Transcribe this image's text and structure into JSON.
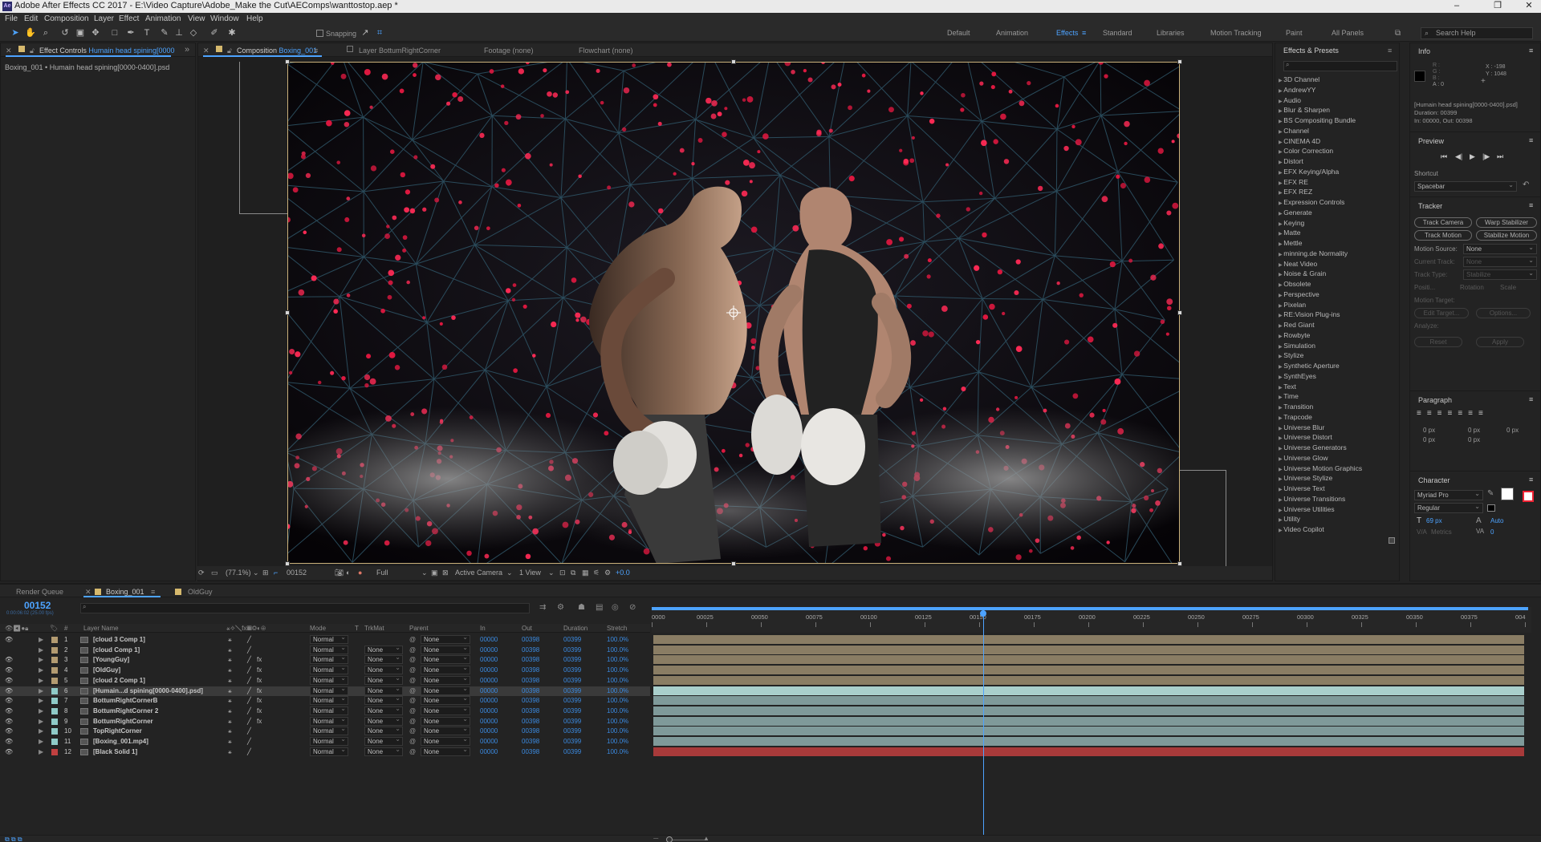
{
  "window": {
    "title": "Adobe After Effects CC 2017 - E:\\Video Capture\\Adobe_Make the Cut\\AEComps\\wanttostop.aep *",
    "app_icon": "Ae",
    "controls": [
      "minimize-icon",
      "restore-icon",
      "close-icon"
    ]
  },
  "menu": [
    "File",
    "Edit",
    "Composition",
    "Layer",
    "Effect",
    "Animation",
    "View",
    "Window",
    "Help"
  ],
  "toolbar": {
    "tools": [
      "selection-tool-icon",
      "hand-tool-icon",
      "zoom-tool-icon",
      "rotate-tool-icon",
      "camera-tool-icon",
      "pan-behind-tool-icon",
      "rectangle-tool-icon",
      "pen-tool-icon",
      "type-tool-icon",
      "brush-tool-icon",
      "clone-tool-icon",
      "eraser-tool-icon",
      "roto-tool-icon",
      "puppet-tool-icon"
    ],
    "snapping_label": "Snapping",
    "workspaces": [
      "Default",
      "Animation",
      "Effects",
      "Standard",
      "Libraries",
      "Motion Tracking",
      "Paint",
      "All Panels"
    ],
    "active_workspace": "Effects",
    "search_placeholder": "Search Help"
  },
  "effect_controls": {
    "tab_label": "Effect Controls",
    "tab_layer": "Humain head spining[0000",
    "subtitle": "Boxing_001 • Humain head spining[0000-0400].psd"
  },
  "viewer": {
    "tabs": {
      "composition_label": "Composition",
      "composition_name": "Boxing_001",
      "layer": "Layer BottumRightCorner",
      "footage": "Footage (none)",
      "flowchart": "Flowchart (none)"
    },
    "zoom": "(77.1%)",
    "timecode": "00152",
    "resolution": "Full",
    "camera": "Active Camera",
    "view": "1 View",
    "exposure": "+0.0"
  },
  "effects_presets": {
    "title": "Effects & Presets",
    "search_placeholder": "",
    "items": [
      "3D Channel",
      "AndrewYY",
      "Audio",
      "Blur & Sharpen",
      "BS Compositing Bundle",
      "Channel",
      "CINEMA 4D",
      "Color Correction",
      "Distort",
      "EFX Keying/Alpha",
      "EFX RE",
      "EFX REZ",
      "Expression Controls",
      "Generate",
      "Keying",
      "Matte",
      "Mettle",
      "minning.de Normality",
      "Neat Video",
      "Noise & Grain",
      "Obsolete",
      "Perspective",
      "Pixelan",
      "RE:Vision Plug-ins",
      "Red Giant",
      "Rowbyte",
      "Simulation",
      "Stylize",
      "Synthetic Aperture",
      "SynthEyes",
      "Text",
      "Time",
      "Transition",
      "Trapcode",
      "Universe Blur",
      "Universe Distort",
      "Universe Generators",
      "Universe Glow",
      "Universe Motion Graphics",
      "Universe Stylize",
      "Universe Text",
      "Universe Transitions",
      "Universe Utilities",
      "Utility",
      "Video Copilot"
    ]
  },
  "info": {
    "title": "Info",
    "channels": [
      "R :",
      "G :",
      "B :",
      "A : 0"
    ],
    "x": "X : -198",
    "y": "Y : 1048",
    "layer_name": "[Humain head spining[0000-0400].psd]",
    "duration": "Duration: 00399",
    "in_out": "In: 00000, Out: 00398"
  },
  "preview": {
    "title": "Preview",
    "shortcut_label": "Shortcut",
    "shortcut_value": "Spacebar"
  },
  "tracker": {
    "title": "Tracker",
    "buttons": [
      "Track Camera",
      "Warp Stabilizer",
      "Track Motion",
      "Stabilize Motion"
    ],
    "motion_source_label": "Motion Source:",
    "motion_source_value": "None",
    "current_track_label": "Current Track:",
    "current_track_value": "None",
    "track_type_label": "Track Type:",
    "track_type_value": "Stabilize",
    "checks": [
      "Positi...",
      "Rotation",
      "Scale"
    ],
    "motion_target": "Motion Target:",
    "edit_target": "Edit Target...",
    "options": "Options...",
    "analyze": "Analyze:",
    "reset": "Reset",
    "apply": "Apply"
  },
  "paragraph": {
    "title": "Paragraph",
    "values": [
      "0 px",
      "0 px",
      "0 px",
      "0 px",
      "0 px"
    ]
  },
  "character": {
    "title": "Character",
    "font": "Myriad Pro",
    "style": "Regular",
    "size": "69 px",
    "leading": "Auto",
    "tracking_label": "Metrics",
    "kerning_value": "0"
  },
  "timeline": {
    "tabs": [
      "Render Queue",
      "Boxing_001",
      "OldGuy"
    ],
    "active_tab": "Boxing_001",
    "timecode": "00152",
    "timecode_sub": "0:00:06:02 (25.00 fps)",
    "search_placeholder": "",
    "headers": {
      "num": "#",
      "layer_name": "Layer Name",
      "mode": "Mode",
      "t": "T",
      "trkmat": "TrkMat",
      "parent": "Parent",
      "in": "In",
      "out": "Out",
      "duration": "Duration",
      "stretch": "Stretch"
    },
    "ruler": [
      "0000",
      "00025",
      "00050",
      "00075",
      "00100",
      "00125",
      "00150",
      "00175",
      "00200",
      "00225",
      "00250",
      "00275",
      "00300",
      "00325",
      "00350",
      "00375",
      "004"
    ],
    "playhead_frame": 152,
    "layers": [
      {
        "num": "1",
        "name": "[cloud 3 Comp 1]",
        "mode": "Normal",
        "trkmat": "",
        "parent": "None",
        "in": "00000",
        "out": "00398",
        "duration": "00399",
        "stretch": "100.0%",
        "color": "#b39b71",
        "track_color": "#8a7d64"
      },
      {
        "num": "2",
        "name": "[cloud Comp 1]",
        "mode": "Normal",
        "trkmat": "None",
        "parent": "None",
        "in": "00000",
        "out": "00398",
        "duration": "00399",
        "stretch": "100.0%",
        "color": "#b39b71",
        "track_color": "#8a7d64"
      },
      {
        "num": "3",
        "name": "[YoungGuy]",
        "mode": "Normal",
        "trkmat": "None",
        "parent": "None",
        "in": "00000",
        "out": "00398",
        "duration": "00399",
        "stretch": "100.0%",
        "color": "#b39b71",
        "track_color": "#8a7d64"
      },
      {
        "num": "4",
        "name": "[OldGuy]",
        "mode": "Normal",
        "trkmat": "None",
        "parent": "None",
        "in": "00000",
        "out": "00398",
        "duration": "00399",
        "stretch": "100.0%",
        "color": "#b39b71",
        "track_color": "#8a7d64"
      },
      {
        "num": "5",
        "name": "[cloud 2 Comp 1]",
        "mode": "Normal",
        "trkmat": "None",
        "parent": "None",
        "in": "00000",
        "out": "00398",
        "duration": "00399",
        "stretch": "100.0%",
        "color": "#b39b71",
        "track_color": "#8a7d64"
      },
      {
        "num": "6",
        "name": "[Humain...d spining[0000-0400].psd]",
        "mode": "Normal",
        "trkmat": "None",
        "parent": "None",
        "in": "00000",
        "out": "00398",
        "duration": "00399",
        "stretch": "100.0%",
        "color": "#8fcbc8",
        "track_color": "#a9cfcc",
        "selected": true
      },
      {
        "num": "7",
        "name": "BottumRightCornerB",
        "mode": "Normal",
        "trkmat": "None",
        "parent": "None",
        "in": "00000",
        "out": "00398",
        "duration": "00399",
        "stretch": "100.0%",
        "color": "#8fcbc8",
        "track_color": "#7f9a9a"
      },
      {
        "num": "8",
        "name": "BottumRightCorner 2",
        "mode": "Normal",
        "trkmat": "None",
        "parent": "None",
        "in": "00000",
        "out": "00398",
        "duration": "00399",
        "stretch": "100.0%",
        "color": "#8fcbc8",
        "track_color": "#7f9a9a"
      },
      {
        "num": "9",
        "name": "BottumRightCorner",
        "mode": "Normal",
        "trkmat": "None",
        "parent": "None",
        "in": "00000",
        "out": "00398",
        "duration": "00399",
        "stretch": "100.0%",
        "color": "#8fcbc8",
        "track_color": "#7f9a9a"
      },
      {
        "num": "10",
        "name": "TopRightCorner",
        "mode": "Normal",
        "trkmat": "None",
        "parent": "None",
        "in": "00000",
        "out": "00398",
        "duration": "00399",
        "stretch": "100.0%",
        "color": "#8fcbc8",
        "track_color": "#7f9a9a"
      },
      {
        "num": "11",
        "name": "[Boxing_001.mp4]",
        "mode": "Normal",
        "trkmat": "None",
        "parent": "None",
        "in": "00000",
        "out": "00398",
        "duration": "00399",
        "stretch": "100.0%",
        "color": "#8fcbc8",
        "track_color": "#7f9a9a"
      },
      {
        "num": "12",
        "name": "[Black Solid 1]",
        "mode": "Normal",
        "trkmat": "None",
        "parent": "None",
        "in": "00000",
        "out": "00398",
        "duration": "00399",
        "stretch": "100.0%",
        "color": "#c04040",
        "track_color": "#a83a3a"
      }
    ]
  },
  "colors": {
    "accent": "#4da3ff",
    "panel_bg": "#232323",
    "timecode_blue": "#3b8ae0"
  }
}
